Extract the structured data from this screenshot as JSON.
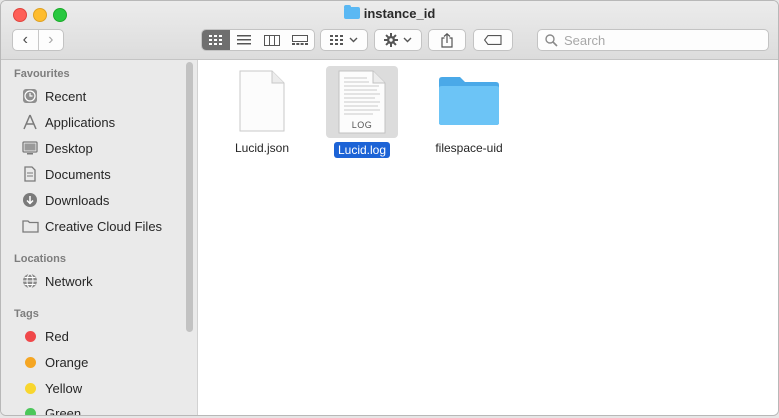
{
  "window": {
    "title": "instance_id"
  },
  "toolbar": {
    "back_label": "‹",
    "forward_label": "›",
    "search_placeholder": "Search"
  },
  "sidebar": {
    "favourites_header": "Favourites",
    "favourites": [
      {
        "label": "Recent",
        "icon": "clock-icon"
      },
      {
        "label": "Applications",
        "icon": "applications-icon"
      },
      {
        "label": "Desktop",
        "icon": "desktop-icon"
      },
      {
        "label": "Documents",
        "icon": "document-icon"
      },
      {
        "label": "Downloads",
        "icon": "download-icon"
      },
      {
        "label": "Creative Cloud Files",
        "icon": "folder-icon"
      }
    ],
    "locations_header": "Locations",
    "locations": [
      {
        "label": "Network",
        "icon": "network-globe-icon"
      }
    ],
    "tags_header": "Tags",
    "tags": [
      {
        "label": "Red",
        "color": "#f0484a"
      },
      {
        "label": "Orange",
        "color": "#f5a623"
      },
      {
        "label": "Yellow",
        "color": "#f8d62e"
      },
      {
        "label": "Green",
        "color": "#4cc75a"
      }
    ]
  },
  "files": [
    {
      "name": "Lucid.json",
      "type": "json-file-icon",
      "selected": false
    },
    {
      "name": "Lucid.log",
      "type": "log-file-icon",
      "badge": "LOG",
      "selected": true
    },
    {
      "name": "filespace-uid",
      "type": "folder-icon",
      "selected": false
    }
  ],
  "colors": {
    "selection": "#1c63d6",
    "folder": "#5ab8f3"
  }
}
